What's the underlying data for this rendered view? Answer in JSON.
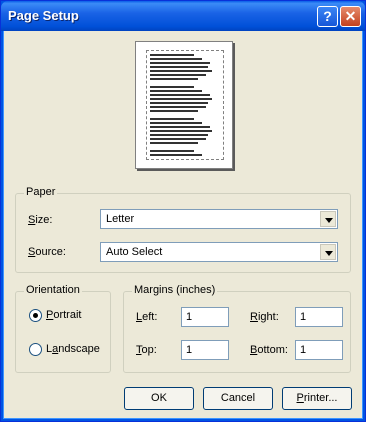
{
  "window": {
    "title": "Page Setup",
    "help_glyph": "?",
    "close_glyph": "✕"
  },
  "paper": {
    "legend": "Paper",
    "size_label_underlined": "S",
    "size_label_rest": "ize:",
    "size_value": "Letter",
    "source_label_underlined": "S",
    "source_label_rest": "ource:",
    "source_value": "Auto Select"
  },
  "orientation": {
    "legend": "Orientation",
    "portrait_underlined": "P",
    "portrait_rest": "ortrait",
    "landscape_rest_a": "L",
    "landscape_underlined": "a",
    "landscape_rest_b": "ndscape",
    "selected": "Portrait"
  },
  "margins": {
    "legend": "Margins (inches)",
    "left_underlined": "L",
    "left_rest": "eft:",
    "left_value": "1",
    "right_underlined": "R",
    "right_rest": "ight:",
    "right_value": "1",
    "top_underlined": "T",
    "top_rest": "op:",
    "top_value": "1",
    "bottom_underlined": "B",
    "bottom_rest": "ottom:",
    "bottom_value": "1"
  },
  "buttons": {
    "ok": "OK",
    "cancel": "Cancel",
    "printer_underlined": "P",
    "printer_rest": "rinter..."
  }
}
